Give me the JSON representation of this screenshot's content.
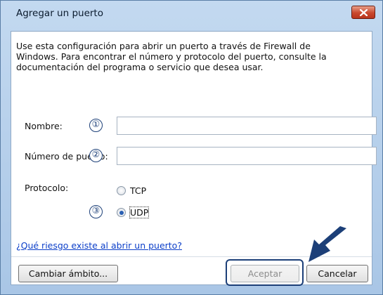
{
  "window": {
    "title": "Agregar un puerto",
    "close_icon": "close-icon"
  },
  "description": "Use esta configuración para abrir un puerto a través de Firewall de\nWindows. Para encontrar el número y protocolo del puerto, consulte la\ndocumentación del programa o servicio que desea usar.",
  "form": {
    "name_label": "Nombre:",
    "name_value": "",
    "port_label": "Número de puerto:",
    "port_value": "",
    "protocol_label": "Protocolo:",
    "protocol_options": [
      "TCP",
      "UDP"
    ],
    "protocol_selected": "UDP"
  },
  "callouts": [
    "①",
    "②",
    "③"
  ],
  "link": "¿Qué riesgo existe al abrir un puerto?",
  "buttons": {
    "change_scope": "Cambiar ámbito...",
    "accept": "Aceptar",
    "cancel": "Cancelar"
  },
  "colors": {
    "callout": "#1c3f78",
    "link": "#0c3fc9",
    "close_button": "#c9482e"
  }
}
